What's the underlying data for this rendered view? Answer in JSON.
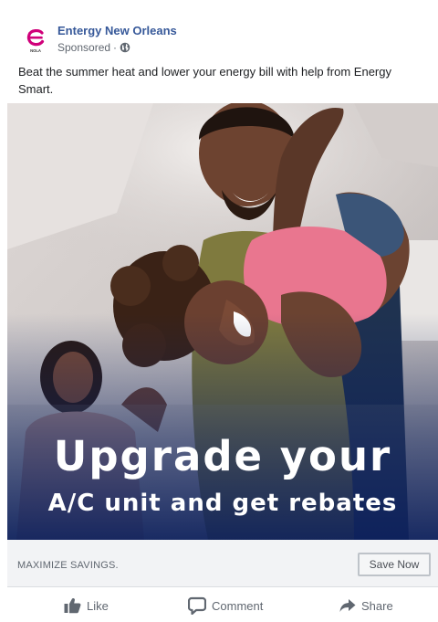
{
  "post": {
    "page_name": "Entergy New Orleans",
    "sponsored_label": "Sponsored",
    "separator": " · ",
    "audience_icon": "globe-icon",
    "avatar_text": "NOLA",
    "brand_color": "#d0007a",
    "text": "Beat the summer heat and lower your energy bill with help from Energy Smart."
  },
  "ad_image": {
    "description_icon": "photo",
    "headline_line1": "Upgrade your",
    "headline_line2": "A/C unit and get rebates"
  },
  "cta": {
    "caption": "MAXIMIZE SAVINGS.",
    "button_label": "Save Now"
  },
  "actions": {
    "like_label": "Like",
    "like_icon": "thumbs-up-icon",
    "comment_label": "Comment",
    "comment_icon": "comment-bubble-icon",
    "share_label": "Share",
    "share_icon": "share-arrow-icon"
  }
}
